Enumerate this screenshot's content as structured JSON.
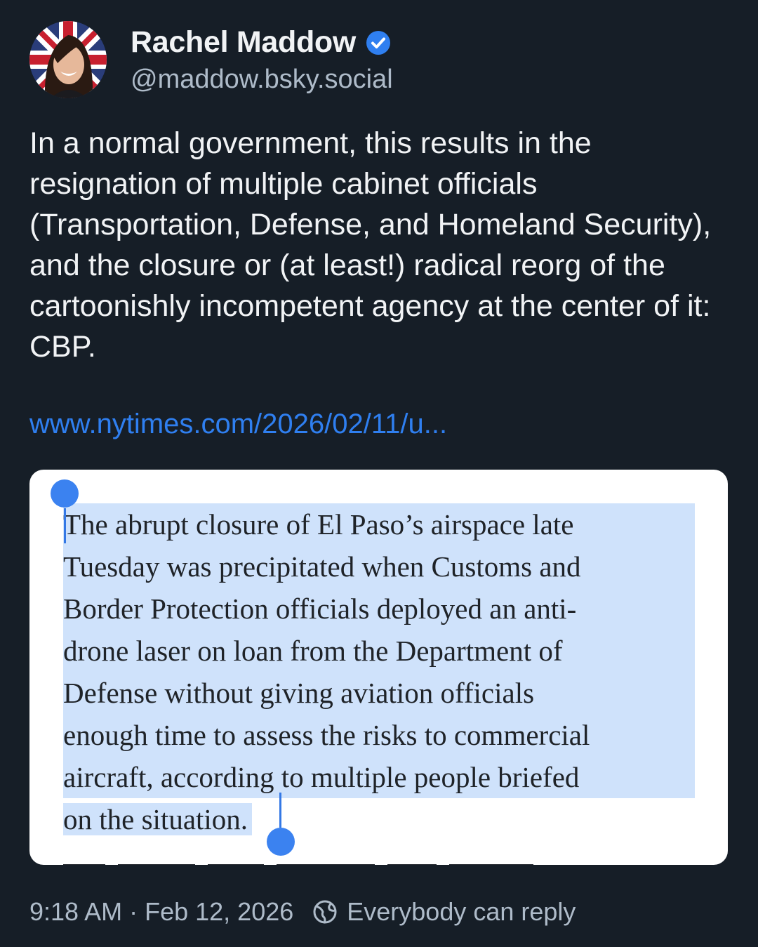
{
  "author": {
    "display_name": "Rachel Maddow",
    "handle": "@maddow.bsky.social",
    "verified_color": "#2f7ff0"
  },
  "post": {
    "text": "In a normal government, this results in the resignation of multiple cabinet officials (Transportation, Defense, and Homeland Security), and the closure or (at least!) radical reorg of the cartoonishly incompetent agency at the center of it: CBP.",
    "link": "www.nytimes.com/2026/02/11/u..."
  },
  "quote": {
    "lines": [
      "The abrupt closure of El Paso’s airspace late",
      "Tuesday was precipitated when Customs and",
      "Border Protection officials deployed an anti-",
      "drone laser on loan from the Department of",
      "Defense without giving aviation officials",
      "enough time to assess the risks to commercial",
      "aircraft, according to multiple people briefed",
      "on the situation."
    ],
    "selection_color": "#cfe2fb",
    "handle_color": "#3b82f0"
  },
  "meta": {
    "time": "9:18 AM",
    "separator": "·",
    "date": "Feb 12, 2026",
    "reply_setting": "Everybody can reply",
    "reply_icon": "globe-icon"
  }
}
